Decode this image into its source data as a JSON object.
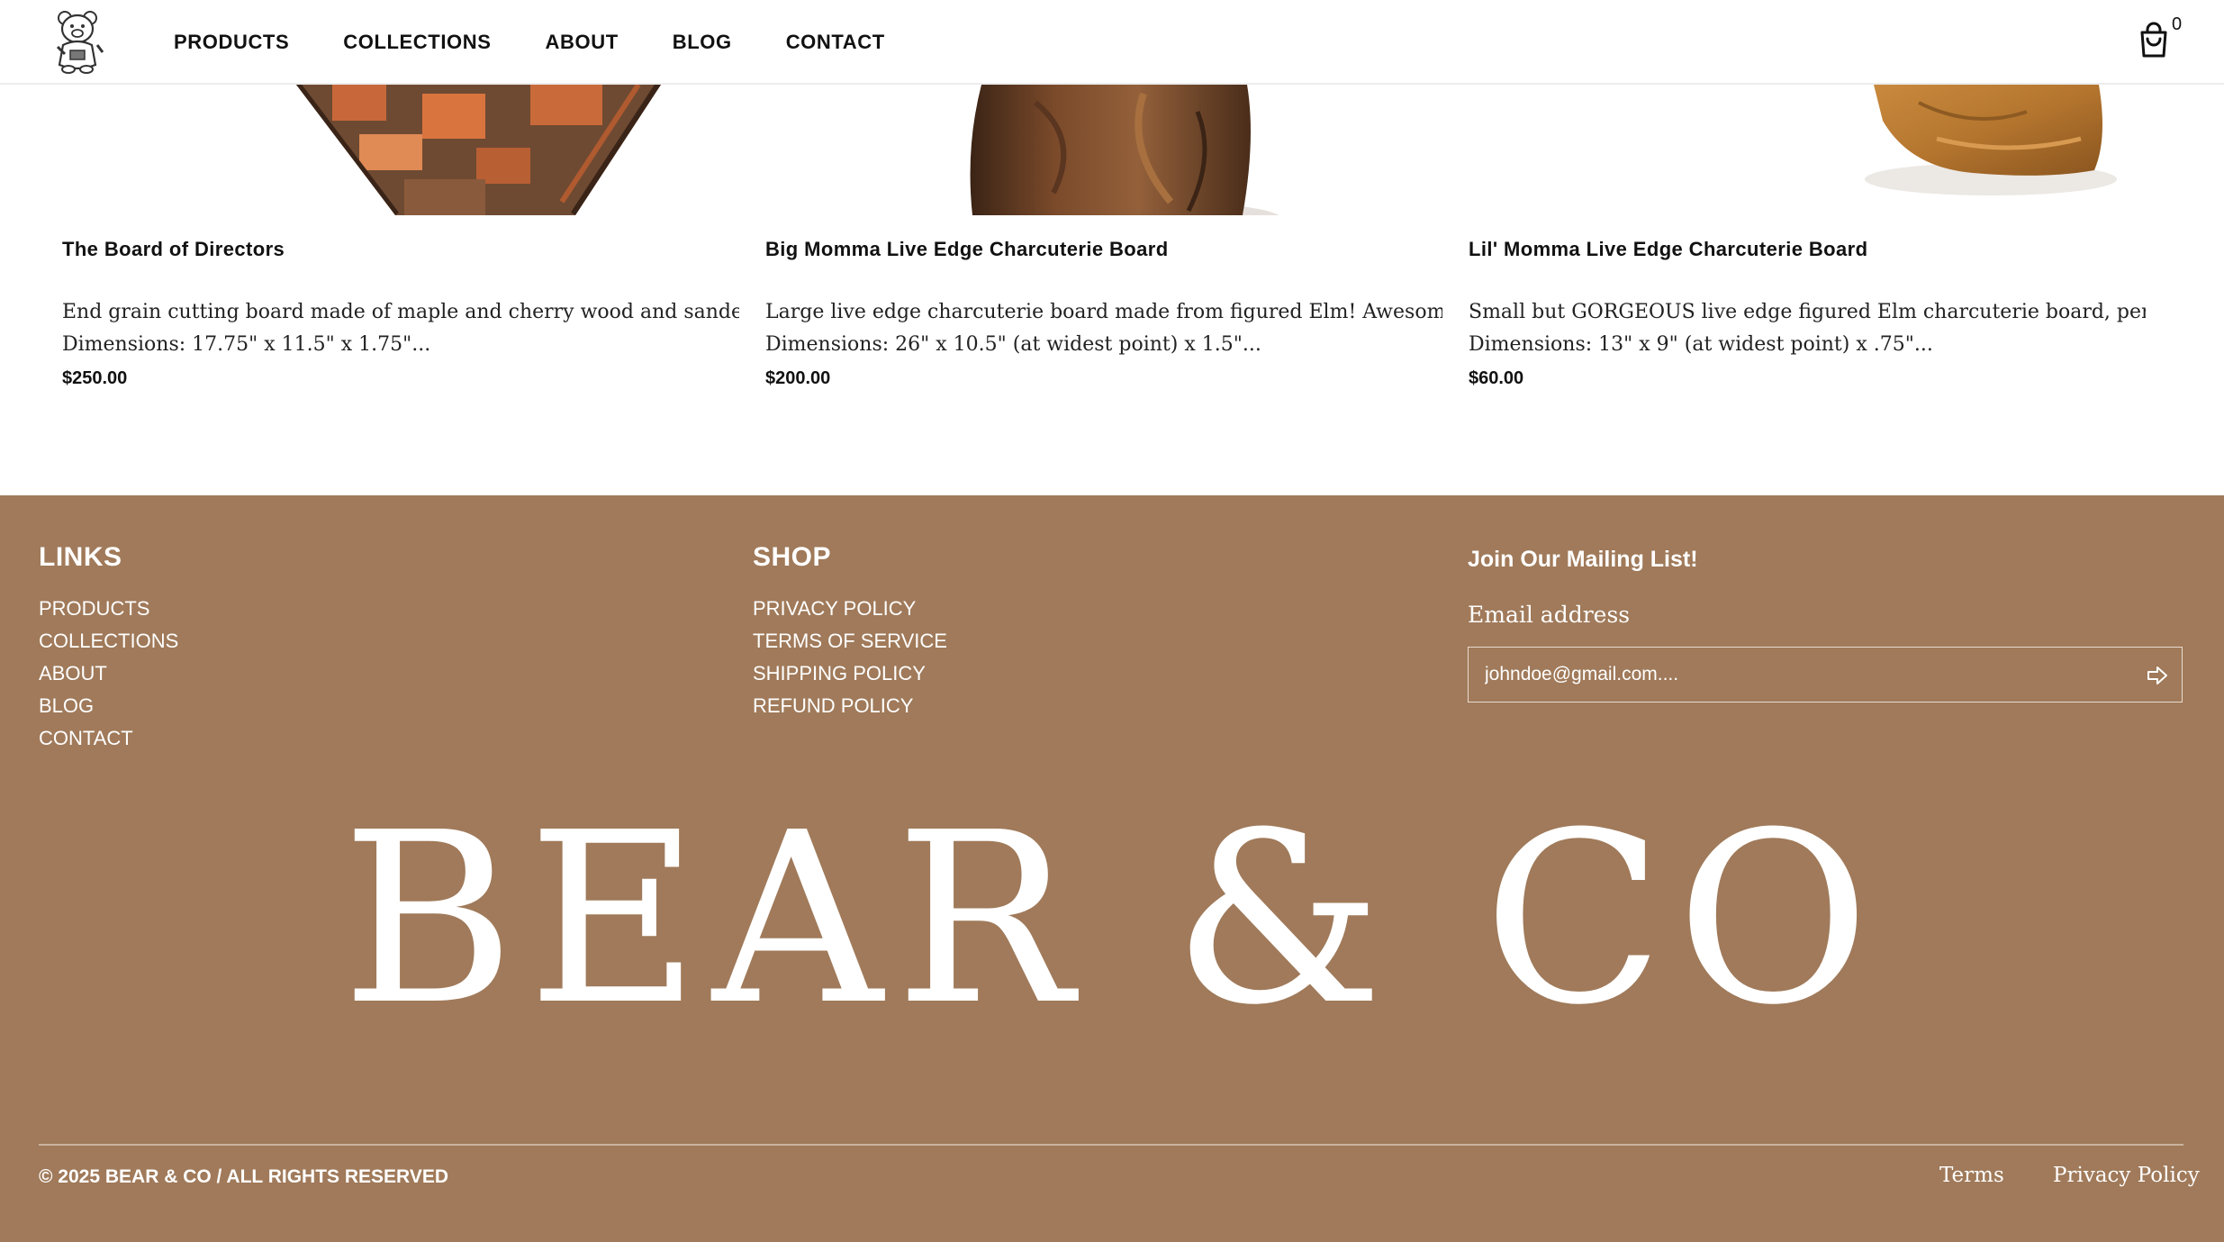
{
  "header": {
    "logo_icon": "bear-mascot-icon",
    "nav": [
      {
        "label": "PRODUCTS"
      },
      {
        "label": "COLLECTIONS"
      },
      {
        "label": "ABOUT"
      },
      {
        "label": "BLOG"
      },
      {
        "label": "CONTACT"
      }
    ],
    "cart_icon": "shopping-bag-icon",
    "cart_count": "0"
  },
  "products": [
    {
      "title": "The Board of Directors",
      "desc_line1": "End grain cutting board made of maple and cherry wood and sanded to buttery smooth finish.",
      "desc_line2": "Dimensions: 17.75\" x 11.5\" x 1.75\"...",
      "price": "$250.00"
    },
    {
      "title": "Big Momma Live Edge Charcuterie Board",
      "desc_line1": "Large live edge charcuterie board made from figured Elm!  Awesome idea for entertaining.",
      "desc_line2": "Dimensions: 26\" x 10.5\" (at widest point) x 1.5\"...",
      "price": "$200.00"
    },
    {
      "title": "Lil' Momma Live Edge Charcuterie Board",
      "desc_line1": "Small but GORGEOUS live edge figured Elm charcuterie board, perfect for small gatherings.",
      "desc_line2": "Dimensions: 13\" x 9\" (at widest point) x .75\"...",
      "price": "$60.00"
    }
  ],
  "footer": {
    "links_title": "LINKS",
    "links": [
      "PRODUCTS",
      "COLLECTIONS",
      "ABOUT",
      "BLOG",
      "CONTACT"
    ],
    "shop_title": "SHOP",
    "shop_links": [
      "PRIVACY POLICY",
      "TERMS OF SERVICE",
      "SHIPPING POLICY",
      "REFUND POLICY"
    ],
    "mailing_title": "Join Our Mailing List!",
    "email_label": "Email address",
    "email_placeholder": "johndoe@gmail.com....",
    "submit_icon": "arrow-right-icon",
    "brand": "BEAR & CO",
    "copyright": "© 2025 BEAR & CO / ALL RIGHTS RESERVED",
    "terms": "Terms",
    "privacy": "Privacy Policy"
  },
  "colors": {
    "footer_bg": "#a07a5a",
    "text_dark": "#111111",
    "white": "#ffffff"
  }
}
